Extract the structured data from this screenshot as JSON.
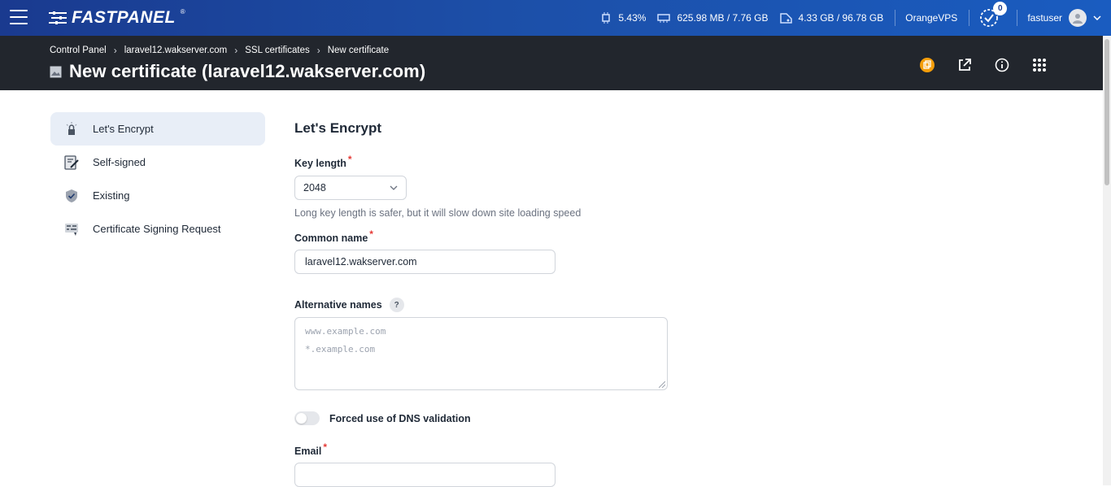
{
  "topbar": {
    "logo": "FASTPANEL",
    "logo_mark": "®",
    "cpu": "5.43%",
    "ram": "625.98 MB / 7.76 GB",
    "disk": "4.33 GB / 96.78 GB",
    "server": "OrangeVPS",
    "tasks_count": "0",
    "user": "fastuser"
  },
  "breadcrumb": [
    "Control Panel",
    "laravel12.wakserver.com",
    "SSL certificates",
    "New certificate"
  ],
  "page_title": "New certificate (laravel12.wakserver.com)",
  "sidebar": {
    "items": [
      {
        "label": "Let's Encrypt"
      },
      {
        "label": "Self-signed"
      },
      {
        "label": "Existing"
      },
      {
        "label": "Certificate Signing Request"
      }
    ]
  },
  "form": {
    "section_title": "Let's Encrypt",
    "key_length_label": "Key length",
    "key_length_value": "2048",
    "key_length_hint": "Long key length is safer, but it will slow down site loading speed",
    "common_name_label": "Common name",
    "common_name_value": "laravel12.wakserver.com",
    "alt_names_label": "Alternative names",
    "alt_names_help": "?",
    "alt_names_placeholder_1": "www.example.com",
    "alt_names_placeholder_2": "*.example.com",
    "dns_toggle_label": "Forced use of DNS validation",
    "email_label": "Email",
    "required_mark": "*"
  },
  "colors": {
    "topbar": "#1c4fa8",
    "header": "#22262d",
    "accent_orange": "#f59e0b",
    "active_item": "#e8eef7"
  }
}
